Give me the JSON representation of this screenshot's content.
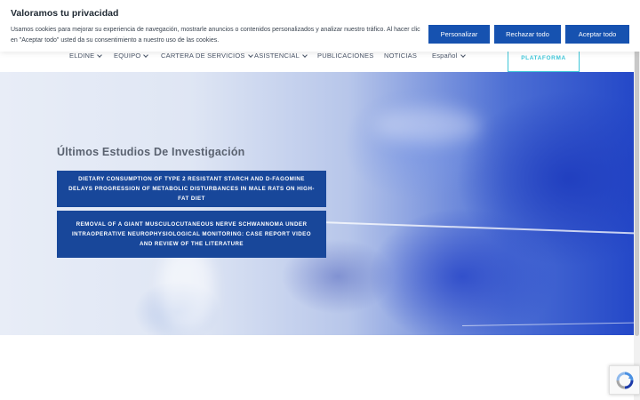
{
  "cookie_banner": {
    "title": "Valoramos tu privacidad",
    "text": "Usamos cookies para mejorar su experiencia de navegación, mostrarle anuncios o contenidos personalizados y analizar nuestro tráfico. Al hacer clic en \"Aceptar todo\" usted da su consentimiento a nuestro uso de las cookies.",
    "buttons": {
      "customize": "Personalizar",
      "reject": "Rechazar todo",
      "accept": "Aceptar todo"
    },
    "button_color": "#1652b0"
  },
  "nav": {
    "items": [
      {
        "label": "ELDINE",
        "dropdown": true
      },
      {
        "label": "EQUIPO",
        "dropdown": true
      },
      {
        "label": "CARTERA DE SERVICIOS",
        "dropdown": true
      },
      {
        "label": "ASISTENCIAL",
        "dropdown": true
      },
      {
        "label": "PUBLICACIONES",
        "dropdown": false
      },
      {
        "label": "NOTICIAS",
        "dropdown": false
      },
      {
        "label": "Español",
        "dropdown": true
      }
    ],
    "platform_button": "PLATAFORMA",
    "accent_color": "#3ec6d8"
  },
  "hero": {
    "section_title": "Últimos Estudios De Investigación",
    "studies": [
      {
        "title": "DIETARY CONSUMPTION OF TYPE 2 RESISTANT STARCH AND D-FAGOMINE DELAYS PROGRESSION OF METABOLIC DISTURBANCES IN MALE RATS ON HIGH-FAT DIET"
      },
      {
        "title": "REMOVAL OF A GIANT MUSCULOCUTANEOUS NERVE SCHWANNOMA UNDER INTRAOPERATIVE NEUROPHYSIOLOGICAL MONITORING: CASE REPORT VIDEO AND REVIEW OF THE LITERATURE"
      }
    ],
    "card_color": "#18479a"
  },
  "icons": {
    "dropdown": "chevron-down-icon",
    "captcha": "recaptcha-icon"
  }
}
